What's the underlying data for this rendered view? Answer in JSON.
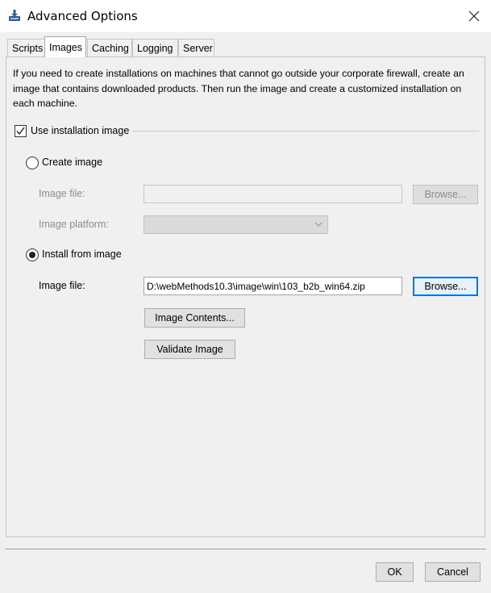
{
  "window": {
    "title": "Advanced Options"
  },
  "tabs": [
    {
      "label": "Scripts"
    },
    {
      "label": "Images",
      "active": true
    },
    {
      "label": "Caching"
    },
    {
      "label": "Logging"
    },
    {
      "label": "Server"
    }
  ],
  "images": {
    "description": "If you need to create installations on machines that cannot go outside your corporate firewall, create an image that contains downloaded products. Then run the image and create a customized installation on each machine.",
    "use_image": {
      "label": "Use installation image",
      "checked": true
    },
    "create_image": {
      "label": "Create image",
      "selected": false,
      "image_file_label": "Image file:",
      "image_file_value": "",
      "browse_label": "Browse...",
      "platform_label": "Image platform:",
      "platform_value": ""
    },
    "install_from_image": {
      "label": "Install from image",
      "selected": true,
      "image_file_label": "Image file:",
      "image_file_value": "D:\\webMethods10.3\\image\\win\\103_b2b_win64.zip",
      "browse_label": "Browse...",
      "image_contents_label": "Image Contents...",
      "validate_label": "Validate Image"
    }
  },
  "footer": {
    "ok_label": "OK",
    "cancel_label": "Cancel"
  },
  "icons": {
    "app": "installer-download-icon",
    "close": "close-icon",
    "check": "checkmark-icon",
    "dropdown": "chevron-down-icon"
  },
  "colors": {
    "focus_border": "#0078d7",
    "disabled_text": "#8c8c8c",
    "window_bg": "#f0f0f0"
  }
}
